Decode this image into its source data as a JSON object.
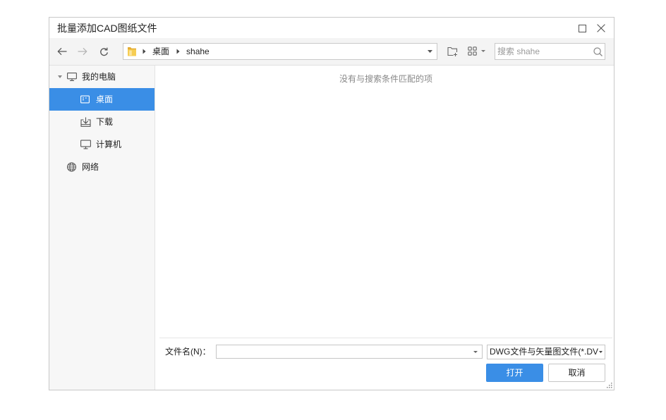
{
  "window": {
    "title": "批量添加CAD图纸文件",
    "maximize_icon": "maximize-icon",
    "close_icon": "close-icon"
  },
  "colors": {
    "accent": "#3a8ee6"
  },
  "toolbar": {
    "nav": {
      "back_icon": "arrow-left-icon",
      "forward_icon": "arrow-right-icon",
      "forward_disabled": true,
      "refresh_icon": "refresh-icon"
    },
    "address_bar": {
      "location_icon": "folder-icon",
      "path": [
        "桌面",
        "shahe"
      ]
    },
    "new_folder_icon": "new-folder-icon",
    "view_icon": "view-grid-icon",
    "search": {
      "placeholder": "搜索 shahe",
      "value": "",
      "icon": "search-icon"
    }
  },
  "sidebar": {
    "tree": [
      {
        "label": "我的电脑",
        "icon": "computer-icon",
        "expanded": true,
        "children": [
          {
            "label": "桌面",
            "icon": "desktop-icon",
            "selected": true
          },
          {
            "label": "下载",
            "icon": "download-icon",
            "selected": false
          },
          {
            "label": "计算机",
            "icon": "monitor-icon",
            "selected": false
          }
        ]
      },
      {
        "label": "网络",
        "icon": "globe-icon",
        "selected": false
      }
    ]
  },
  "main": {
    "empty_message": "没有与搜索条件匹配的项"
  },
  "footer": {
    "filename": {
      "label": "文件名(N)：",
      "value": ""
    },
    "filetype": {
      "selected": "DWG文件与矢量图文件(*.DV"
    },
    "open_label": "打开",
    "cancel_label": "取消"
  }
}
